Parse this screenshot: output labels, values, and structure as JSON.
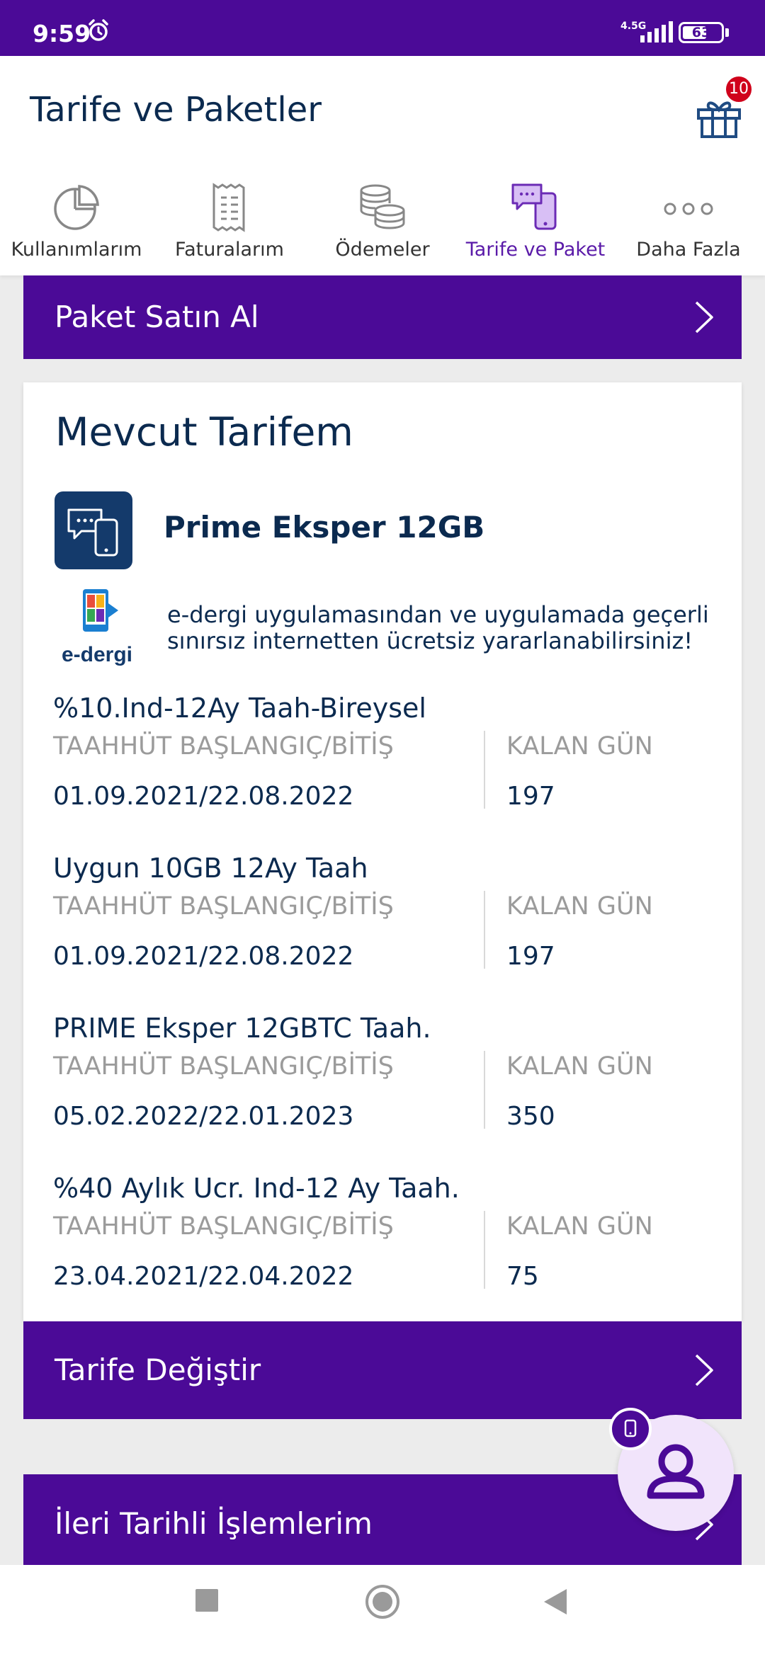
{
  "status_bar": {
    "time": "9:59",
    "network": "4.5G",
    "battery": "63",
    "battery_level": 0.63
  },
  "header": {
    "title": "Tarife ve Paketler",
    "gift_badge": "10"
  },
  "tabs": [
    {
      "label": "Kullanımlarım",
      "icon": "pie-chart-icon",
      "active": false
    },
    {
      "label": "Faturalarım",
      "icon": "receipt-icon",
      "active": false
    },
    {
      "label": "Ödemeler",
      "icon": "coins-icon",
      "active": false
    },
    {
      "label": "Tarife ve Paket",
      "icon": "phone-chat-icon",
      "active": true
    },
    {
      "label": "Daha Fazla",
      "icon": "more-icon",
      "active": false
    }
  ],
  "buy_bar": {
    "label": "Paket Satın Al"
  },
  "tariff": {
    "title": "Mevcut Tarifem",
    "name": "Prime Eksper 12GB",
    "edergi_logo": "e-dergi",
    "edergi_text": "e-dergi uygulamasından ve uygulamada geçerli sınırsız internetten ücretsiz yararlanabilirsiniz!",
    "commitments": [
      {
        "name": "%10.Ind-12Ay Taah-Bireysel",
        "start_end_label": "TAAHHÜT BAŞLANGIÇ/BİTİŞ",
        "days_label": "KALAN GÜN",
        "dates": "01.09.2021/22.08.2022",
        "days": "197"
      },
      {
        "name": "Uygun 10GB 12Ay Taah",
        "start_end_label": "TAAHHÜT BAŞLANGIÇ/BİTİŞ",
        "days_label": "KALAN GÜN",
        "dates": "01.09.2021/22.08.2022",
        "days": "197"
      },
      {
        "name": "PRIME Eksper 12GBTC Taah.",
        "start_end_label": "TAAHHÜT BAŞLANGIÇ/BİTİŞ",
        "days_label": "KALAN GÜN",
        "dates": "05.02.2022/22.01.2023",
        "days": "350"
      },
      {
        "name": "%40 Aylık Ucr. Ind-12 Ay Taah.",
        "start_end_label": "TAAHHÜT BAŞLANGIÇ/BİTİŞ",
        "days_label": "KALAN GÜN",
        "dates": "23.04.2021/22.04.2022",
        "days": "75"
      }
    ]
  },
  "change_bar": {
    "label": "Tarife Değiştir"
  },
  "future_bar": {
    "label": "İleri Tarihli İşlemlerim"
  },
  "colors": {
    "brand": "#4b0a97",
    "text": "#0b2a4f",
    "muted": "#9b9b9b",
    "badge": "#d0021b"
  }
}
